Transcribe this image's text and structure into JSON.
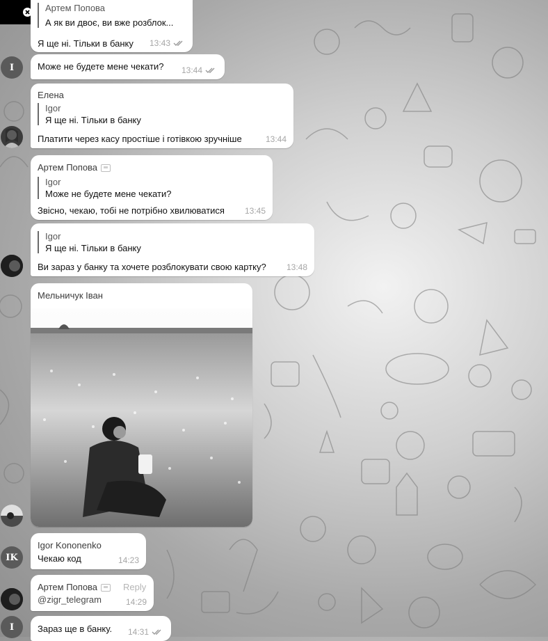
{
  "messages": [
    {
      "id": "m1",
      "reply": {
        "name": "Артем Попова",
        "text": "А як ви двоє, ви вже розблок..."
      },
      "text": "Я ще ні. Тільки в банку",
      "time": "13:43"
    },
    {
      "id": "m2",
      "avatar": "I",
      "text": "Може не будете мене чекати?",
      "time": "13:44"
    },
    {
      "id": "m3",
      "name": "Елена",
      "reply": {
        "name": "Igor",
        "text": "Я ще ні. Тільки в банку"
      },
      "text": "Платити через касу простіше і готівкою зручніше",
      "time": "13:44"
    },
    {
      "id": "m4",
      "name": "Артем Попова",
      "reply": {
        "name": "Igor",
        "text": "Може не будете мене чекати?"
      },
      "text": "Звісно, чекаю, тобі не потрібно хвилюватися",
      "time": "13:45"
    },
    {
      "id": "m5",
      "reply": {
        "name": "Igor",
        "text": "Я ще ні. Тільки в банку"
      },
      "text": "Ви зараз у банку та хочете розблокувати свою картку?",
      "time": "13:48"
    },
    {
      "id": "m6",
      "name": "Мельничук Іван"
    },
    {
      "id": "m7",
      "avatar": "IK",
      "name": "Igor Kononenko",
      "text": "Чекаю код",
      "time": "14:23"
    },
    {
      "id": "m8",
      "name": "Артем Попова",
      "reply_label": "Reply",
      "text": "@zigr_telegram",
      "time": "14:29"
    },
    {
      "id": "m9",
      "avatar": "I",
      "text": "Зараз ще в банку.",
      "time": "14:31"
    }
  ],
  "colors": {
    "bubble": "#ffffff",
    "check": "#9a9a9a",
    "meta": "#a6a6a6"
  }
}
